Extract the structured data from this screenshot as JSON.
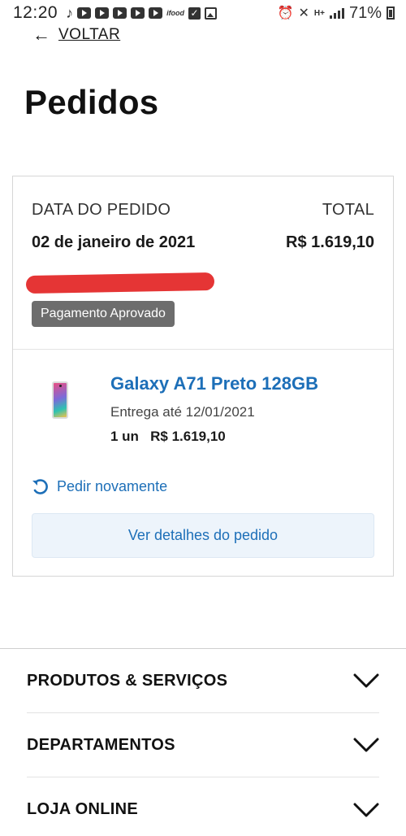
{
  "status_bar": {
    "time": "12:20",
    "battery_percent": "71%",
    "icons_left": [
      "tiktok-icon",
      "youtube-icon",
      "youtube-icon",
      "youtube-icon",
      "youtube-icon",
      "youtube-icon",
      "app-logo-icon",
      "check-icon",
      "gallery-icon"
    ],
    "icons_right": [
      "alarm-icon",
      "mute-icon",
      "hplus-data-icon",
      "signal-icon",
      "battery-icon"
    ],
    "small_logo_text": "ifood"
  },
  "header": {
    "back_label": "VOLTAR",
    "page_title": "Pedidos"
  },
  "order": {
    "date_label": "DATA DO PEDIDO",
    "date_value": "02 de janeiro de 2021",
    "total_label": "TOTAL",
    "total_value": "R$ 1.619,10",
    "status_badge": "Pagamento Aprovado",
    "item": {
      "name": "Galaxy A71 Preto 128GB",
      "delivery": "Entrega até 12/01/2021",
      "quantity_price": "1 un   R$ 1.619,10"
    },
    "reorder_label": "Pedir novamente",
    "details_button": "Ver detalhes do pedido"
  },
  "footer_nav": [
    {
      "label": "PRODUTOS & SERVIÇOS"
    },
    {
      "label": "DEPARTAMENTOS"
    },
    {
      "label": "LOJA ONLINE"
    }
  ],
  "colors": {
    "link_blue": "#1d6fb8",
    "badge_gray": "#6d6d6d",
    "redaction_red": "#e53535",
    "button_bg": "#edf4fb"
  }
}
